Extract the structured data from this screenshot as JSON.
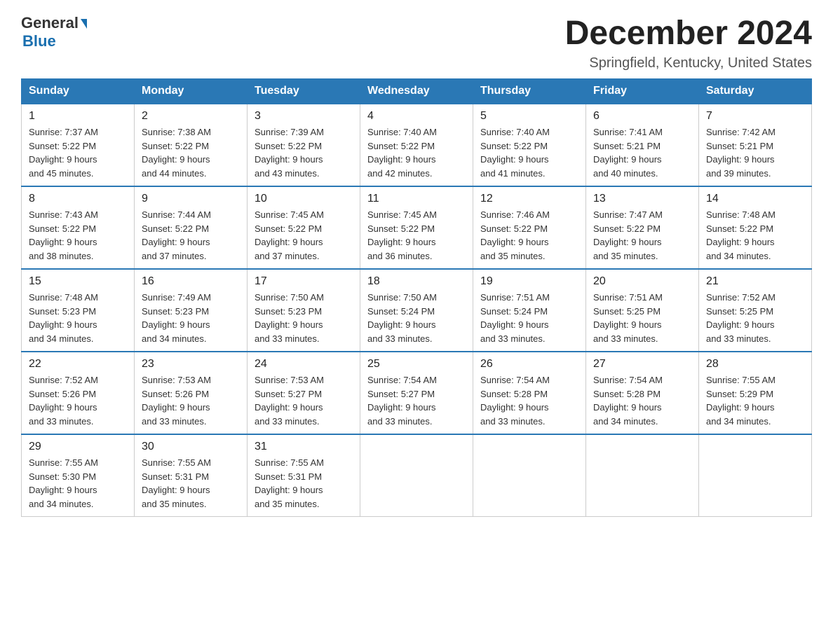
{
  "header": {
    "logo_text_general": "General",
    "logo_text_blue": "Blue",
    "month_title": "December 2024",
    "location": "Springfield, Kentucky, United States"
  },
  "days_of_week": [
    "Sunday",
    "Monday",
    "Tuesday",
    "Wednesday",
    "Thursday",
    "Friday",
    "Saturday"
  ],
  "weeks": [
    [
      {
        "date": "1",
        "sunrise": "7:37 AM",
        "sunset": "5:22 PM",
        "daylight": "9 hours and 45 minutes."
      },
      {
        "date": "2",
        "sunrise": "7:38 AM",
        "sunset": "5:22 PM",
        "daylight": "9 hours and 44 minutes."
      },
      {
        "date": "3",
        "sunrise": "7:39 AM",
        "sunset": "5:22 PM",
        "daylight": "9 hours and 43 minutes."
      },
      {
        "date": "4",
        "sunrise": "7:40 AM",
        "sunset": "5:22 PM",
        "daylight": "9 hours and 42 minutes."
      },
      {
        "date": "5",
        "sunrise": "7:40 AM",
        "sunset": "5:22 PM",
        "daylight": "9 hours and 41 minutes."
      },
      {
        "date": "6",
        "sunrise": "7:41 AM",
        "sunset": "5:21 PM",
        "daylight": "9 hours and 40 minutes."
      },
      {
        "date": "7",
        "sunrise": "7:42 AM",
        "sunset": "5:21 PM",
        "daylight": "9 hours and 39 minutes."
      }
    ],
    [
      {
        "date": "8",
        "sunrise": "7:43 AM",
        "sunset": "5:22 PM",
        "daylight": "9 hours and 38 minutes."
      },
      {
        "date": "9",
        "sunrise": "7:44 AM",
        "sunset": "5:22 PM",
        "daylight": "9 hours and 37 minutes."
      },
      {
        "date": "10",
        "sunrise": "7:45 AM",
        "sunset": "5:22 PM",
        "daylight": "9 hours and 37 minutes."
      },
      {
        "date": "11",
        "sunrise": "7:45 AM",
        "sunset": "5:22 PM",
        "daylight": "9 hours and 36 minutes."
      },
      {
        "date": "12",
        "sunrise": "7:46 AM",
        "sunset": "5:22 PM",
        "daylight": "9 hours and 35 minutes."
      },
      {
        "date": "13",
        "sunrise": "7:47 AM",
        "sunset": "5:22 PM",
        "daylight": "9 hours and 35 minutes."
      },
      {
        "date": "14",
        "sunrise": "7:48 AM",
        "sunset": "5:22 PM",
        "daylight": "9 hours and 34 minutes."
      }
    ],
    [
      {
        "date": "15",
        "sunrise": "7:48 AM",
        "sunset": "5:23 PM",
        "daylight": "9 hours and 34 minutes."
      },
      {
        "date": "16",
        "sunrise": "7:49 AM",
        "sunset": "5:23 PM",
        "daylight": "9 hours and 34 minutes."
      },
      {
        "date": "17",
        "sunrise": "7:50 AM",
        "sunset": "5:23 PM",
        "daylight": "9 hours and 33 minutes."
      },
      {
        "date": "18",
        "sunrise": "7:50 AM",
        "sunset": "5:24 PM",
        "daylight": "9 hours and 33 minutes."
      },
      {
        "date": "19",
        "sunrise": "7:51 AM",
        "sunset": "5:24 PM",
        "daylight": "9 hours and 33 minutes."
      },
      {
        "date": "20",
        "sunrise": "7:51 AM",
        "sunset": "5:25 PM",
        "daylight": "9 hours and 33 minutes."
      },
      {
        "date": "21",
        "sunrise": "7:52 AM",
        "sunset": "5:25 PM",
        "daylight": "9 hours and 33 minutes."
      }
    ],
    [
      {
        "date": "22",
        "sunrise": "7:52 AM",
        "sunset": "5:26 PM",
        "daylight": "9 hours and 33 minutes."
      },
      {
        "date": "23",
        "sunrise": "7:53 AM",
        "sunset": "5:26 PM",
        "daylight": "9 hours and 33 minutes."
      },
      {
        "date": "24",
        "sunrise": "7:53 AM",
        "sunset": "5:27 PM",
        "daylight": "9 hours and 33 minutes."
      },
      {
        "date": "25",
        "sunrise": "7:54 AM",
        "sunset": "5:27 PM",
        "daylight": "9 hours and 33 minutes."
      },
      {
        "date": "26",
        "sunrise": "7:54 AM",
        "sunset": "5:28 PM",
        "daylight": "9 hours and 33 minutes."
      },
      {
        "date": "27",
        "sunrise": "7:54 AM",
        "sunset": "5:28 PM",
        "daylight": "9 hours and 34 minutes."
      },
      {
        "date": "28",
        "sunrise": "7:55 AM",
        "sunset": "5:29 PM",
        "daylight": "9 hours and 34 minutes."
      }
    ],
    [
      {
        "date": "29",
        "sunrise": "7:55 AM",
        "sunset": "5:30 PM",
        "daylight": "9 hours and 34 minutes."
      },
      {
        "date": "30",
        "sunrise": "7:55 AM",
        "sunset": "5:31 PM",
        "daylight": "9 hours and 35 minutes."
      },
      {
        "date": "31",
        "sunrise": "7:55 AM",
        "sunset": "5:31 PM",
        "daylight": "9 hours and 35 minutes."
      },
      null,
      null,
      null,
      null
    ]
  ],
  "labels": {
    "sunrise": "Sunrise:",
    "sunset": "Sunset:",
    "daylight": "Daylight:"
  }
}
